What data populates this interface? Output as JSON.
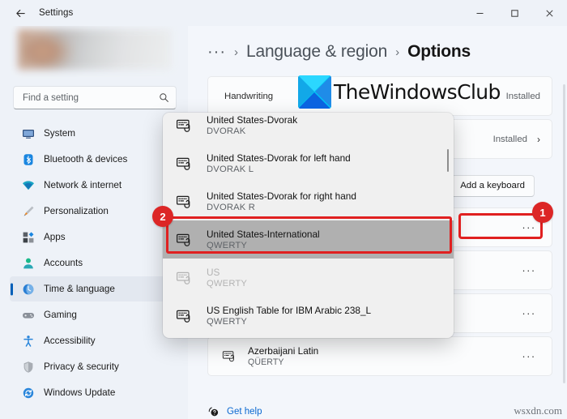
{
  "window": {
    "title": "Settings",
    "back_icon": "back-arrow-icon",
    "minimize_label": "–",
    "maximize_label": "□",
    "close_label": "✕"
  },
  "sidebar": {
    "search": {
      "placeholder": "Find a setting",
      "icon": "search-icon"
    },
    "items": [
      {
        "label": "System",
        "icon": "monitor-icon",
        "selected": false
      },
      {
        "label": "Bluetooth & devices",
        "icon": "bluetooth-icon",
        "selected": false
      },
      {
        "label": "Network & internet",
        "icon": "wifi-icon",
        "selected": false
      },
      {
        "label": "Personalization",
        "icon": "paintbrush-icon",
        "selected": false
      },
      {
        "label": "Apps",
        "icon": "apps-grid-icon",
        "selected": false
      },
      {
        "label": "Accounts",
        "icon": "person-icon",
        "selected": false
      },
      {
        "label": "Time & language",
        "icon": "clock-globe-icon",
        "selected": true
      },
      {
        "label": "Gaming",
        "icon": "gamepad-icon",
        "selected": false
      },
      {
        "label": "Accessibility",
        "icon": "accessibility-person-icon",
        "selected": false
      },
      {
        "label": "Privacy & security",
        "icon": "shield-icon",
        "selected": false
      },
      {
        "label": "Windows Update",
        "icon": "update-arrows-icon",
        "selected": false
      }
    ]
  },
  "breadcrumb": {
    "overflow": "···",
    "separator": "›",
    "parent": "Language & region",
    "current": "Options"
  },
  "main": {
    "handwriting_row": {
      "label": "Handwriting",
      "status": "Installed"
    },
    "installed_row": {
      "status": "Installed",
      "chevron": "›"
    },
    "add_keyboard_button": "Add a keyboard",
    "keyboard_rows": [
      {
        "title": "",
        "subtitle": "",
        "menu": "···"
      },
      {
        "title": "",
        "subtitle": "",
        "menu": "···"
      },
      {
        "title": "",
        "subtitle": "",
        "menu": "···"
      },
      {
        "title": "Azerbaijani Latin",
        "subtitle": "QÜERTY",
        "menu": "···"
      }
    ],
    "get_help": {
      "label": "Get help",
      "icon": "help-question-icon"
    }
  },
  "flyout": {
    "items": [
      {
        "title": "United States-Dvorak",
        "subtitle": "DVORAK",
        "icon": "keyboard-layout-icon",
        "state": "clipped"
      },
      {
        "title": "United States-Dvorak for left hand",
        "subtitle": "DVORAK L",
        "icon": "keyboard-layout-icon",
        "state": "normal"
      },
      {
        "title": "United States-Dvorak for right hand",
        "subtitle": "DVORAK R",
        "icon": "keyboard-layout-icon",
        "state": "normal"
      },
      {
        "title": "United States-International",
        "subtitle": "QWERTY",
        "icon": "keyboard-layout-icon",
        "state": "highlighted"
      },
      {
        "title": "US",
        "subtitle": "QWERTY",
        "icon": "keyboard-layout-icon",
        "state": "disabled"
      },
      {
        "title": "US English Table for IBM Arabic 238_L",
        "subtitle": "QWERTY",
        "icon": "keyboard-layout-icon",
        "state": "normal"
      }
    ]
  },
  "annotations": {
    "badge_one": "1",
    "badge_two": "2",
    "accent_color": "#dc2626"
  },
  "watermarks": {
    "logo_text": "TheWindowsClub",
    "corner_text": "wsxdn.com"
  }
}
